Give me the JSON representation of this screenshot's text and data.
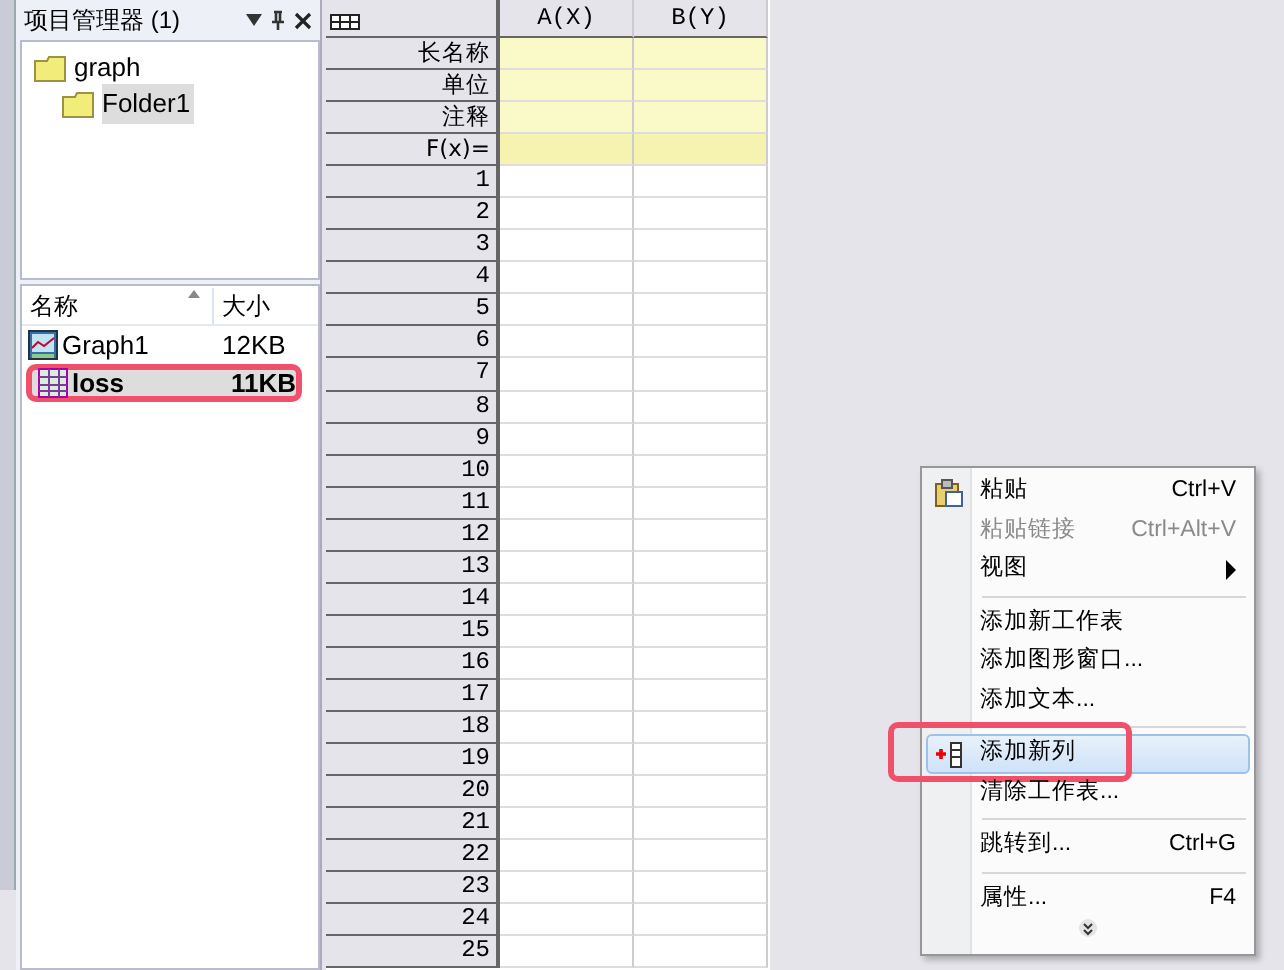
{
  "project_explorer": {
    "title": "项目管理器 (1)",
    "tree": [
      {
        "label": "graph",
        "selected": false,
        "children": [
          {
            "label": "Folder1",
            "selected": true
          }
        ]
      }
    ],
    "columns": [
      "名称",
      "大小"
    ],
    "files": [
      {
        "name": "Graph1",
        "size": "12KB",
        "kind": "graph",
        "selected": false,
        "annotated": false
      },
      {
        "name": "loss",
        "size": "11KB",
        "kind": "worksheet",
        "selected": true,
        "annotated": true
      }
    ]
  },
  "worksheet": {
    "columns": [
      "A(X)",
      "B(Y)"
    ],
    "label_rows": [
      "长名称",
      "单位",
      "注释",
      "F(x)="
    ],
    "row_numbers": [
      "1",
      "2",
      "3",
      "4",
      "5",
      "6",
      "7",
      "8",
      "9",
      "10",
      "11",
      "12",
      "13",
      "14",
      "15",
      "16",
      "17",
      "18",
      "19",
      "20",
      "21",
      "22",
      "23",
      "24",
      "25"
    ]
  },
  "context_menu": {
    "items": [
      {
        "kind": "paste",
        "label": "粘贴",
        "shortcut": "Ctrl+V",
        "disabled": false,
        "submenu": false,
        "selected": false,
        "annotated": false
      },
      {
        "kind": "command",
        "label": "粘贴链接",
        "shortcut": "Ctrl+Alt+V",
        "disabled": true,
        "submenu": false,
        "selected": false,
        "annotated": false
      },
      {
        "kind": "command",
        "label": "视图",
        "disabled": false,
        "submenu": true,
        "selected": false,
        "annotated": false
      },
      {
        "kind": "separator"
      },
      {
        "kind": "command",
        "label": "添加新工作表",
        "disabled": false,
        "submenu": false,
        "selected": false,
        "annotated": false
      },
      {
        "kind": "command",
        "label": "添加图形窗口...",
        "disabled": false,
        "submenu": false,
        "selected": false,
        "annotated": false
      },
      {
        "kind": "command",
        "label": "添加文本...",
        "disabled": false,
        "submenu": false,
        "selected": false,
        "annotated": false
      },
      {
        "kind": "separator"
      },
      {
        "kind": "addcolumn",
        "label": "添加新列",
        "disabled": false,
        "submenu": false,
        "selected": true,
        "annotated": true
      },
      {
        "kind": "command",
        "label": "清除工作表...",
        "disabled": false,
        "submenu": false,
        "selected": false,
        "annotated": false
      },
      {
        "kind": "separator"
      },
      {
        "kind": "command",
        "label": "跳转到...",
        "shortcut": "Ctrl+G",
        "disabled": false,
        "submenu": false,
        "selected": false,
        "annotated": false
      },
      {
        "kind": "separator"
      },
      {
        "kind": "command",
        "label": "属性...",
        "shortcut": "F4",
        "disabled": false,
        "submenu": false,
        "selected": false,
        "annotated": false
      },
      {
        "kind": "more"
      }
    ]
  }
}
